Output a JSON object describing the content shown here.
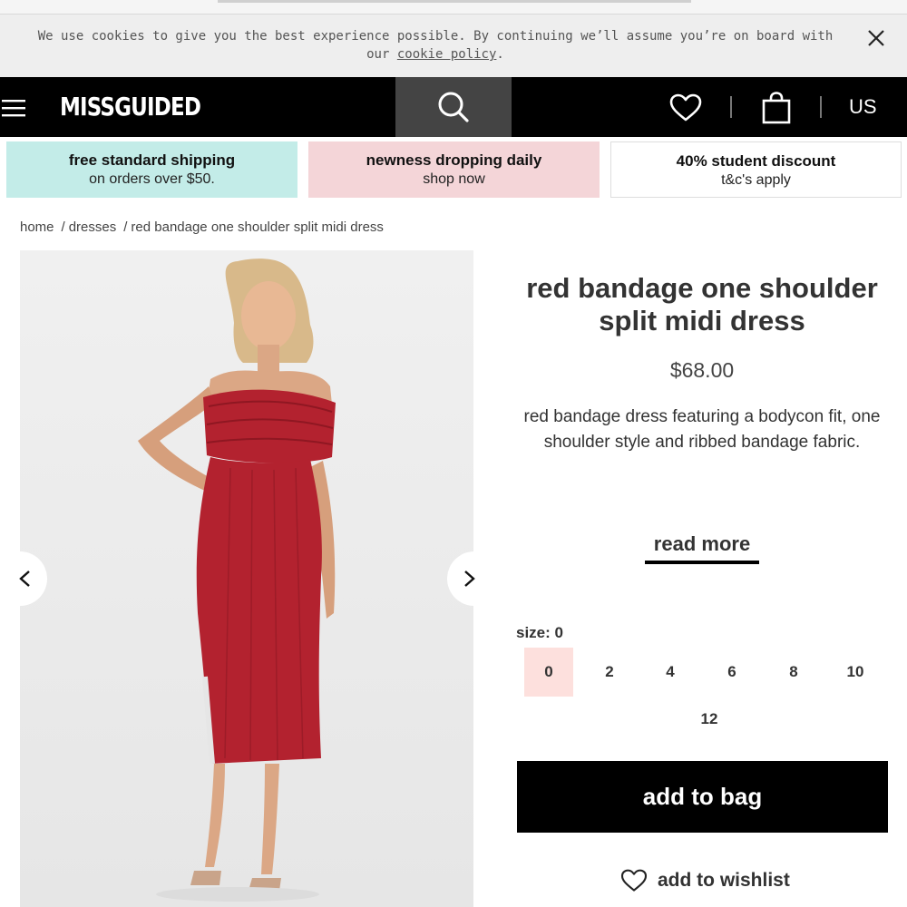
{
  "cookie_bar": {
    "text_before": "We use cookies to give you the best experience possible. By continuing we’ll assume you’re on board with our ",
    "link_text": "cookie policy",
    "text_after": "."
  },
  "header": {
    "logo": "MISSGUIDED",
    "region": "US"
  },
  "promos": [
    {
      "line1": "free standard shipping",
      "line2": "on orders over $50.",
      "color": "#c3ece8"
    },
    {
      "line1": "newness dropping daily",
      "line2": "shop now",
      "color": "#f4d5d8"
    },
    {
      "line1": "40% student discount",
      "line2": "t&c's apply",
      "color": "#ffffff"
    }
  ],
  "breadcrumb": {
    "items": [
      "home",
      "dresses",
      "red bandage one shoulder split midi dress"
    ],
    "separator": "/"
  },
  "product": {
    "title": "red bandage one shoulder split midi dress",
    "price": "$68.00",
    "description": "red bandage dress featuring a bodycon fit, one shoulder style and ribbed bandage fabric.",
    "read_more": "read more",
    "size_label": "size: 0",
    "sizes": [
      "0",
      "2",
      "4",
      "6",
      "8",
      "10",
      "12"
    ],
    "selected_size": "0",
    "add_to_bag": "add to bag",
    "add_to_wishlist": "add to wishlist",
    "dress_color": "#b3222f"
  },
  "icons": {
    "menu": "hamburger-menu-icon",
    "search": "search-icon",
    "wishlist": "heart-icon",
    "bag": "shopping-bag-icon",
    "close": "close-icon",
    "prev": "chevron-left-icon",
    "next": "chevron-right-icon"
  }
}
